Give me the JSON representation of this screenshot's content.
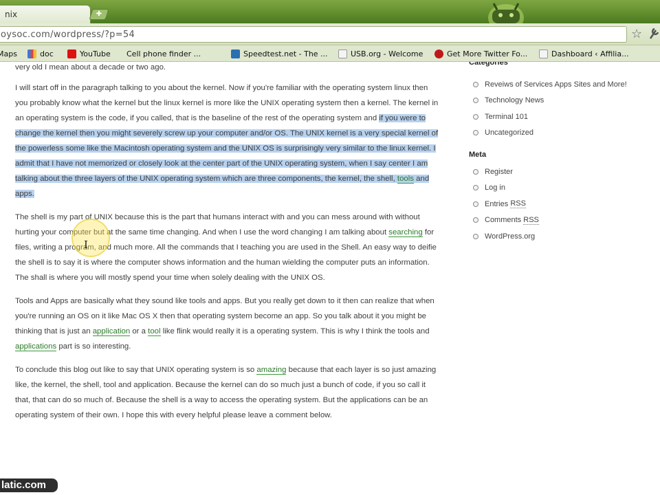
{
  "browser": {
    "tab_title": "nix",
    "url": "oysoc.com/wordpress/?p=54",
    "bookmarks": [
      {
        "label": "Maps",
        "color": "#3b7bd6"
      },
      {
        "label": "doc",
        "color": "#d44"
      },
      {
        "label": "YouTube",
        "color": "#d11"
      },
      {
        "label": "Cell phone finder ...",
        "color": "#e8a23a"
      },
      {
        "label": "Speedtest.net - The ...",
        "color": "#2a6fb0"
      },
      {
        "label": "USB.org - Welcome",
        "color": "#e6e6e6"
      },
      {
        "label": "Get More Twitter Fo...",
        "color": "#c0181a"
      },
      {
        "label": "Dashboard ‹ Affilia...",
        "color": "#f0f0f0"
      }
    ]
  },
  "article": {
    "p0": "very old I mean about a decade or two ago.",
    "p1_a": "I will start off in the paragraph talking to you about the kernel. Now if you're familiar with the operating system linux then you probably know what the kernel but the linux kernel is more like the UNIX operating system then a kernel. The kernel in an operating system is the code, if you called, that is the baseline of the rest of the operating system and ",
    "p1_hl": "if you were to change the kernel then you might severely screw up your computer and/or OS. The UNIX kernel is a very special kernel of the powerless some like the Macintosh operating system and the UNIX OS is surprisingly very similar to the linux kernel. I admit that I have not memorized or closely look at the center part of the UNIX operating system, when I say center I am talking about the three layers of the UNIX operating system which are three components, the kernel, the shell, ",
    "p1_link": "tools",
    "p1_end": " and apps.",
    "p2_a": "The shell is my part of UNIX because this is the part that humans interact with and you can mess around with without hurting your computer but at the same time changing. And when I use the word changing I am talking about ",
    "p2_link": "searching",
    "p2_b": " for files, writing a program, and much more. All the commands that I teaching you are used in the Shell. An easy way to deifie the shell is to say it is where the computer shows information and the human wielding the computer puts an information. The shall is where you will mostly spend your time when solely dealing with the UNIX OS.",
    "p3_a": "Tools and Apps are basically what they sound like tools and apps. But you really get down to it then can realize that when you're running an OS on it like Mac OS X then that operating system become an app. So you talk about it you might be thinking that is just an ",
    "p3_link1": "application",
    "p3_b": " or a ",
    "p3_link2": "tool",
    "p3_c": " like flink would really it is a operating system. This is why I think the tools and ",
    "p3_link3": "applications",
    "p3_d": " part is so interesting.",
    "p4_a": "To conclude this blog out like to say that UNIX operating system is so ",
    "p4_link": "amazing",
    "p4_b": " because that each layer is so just amazing like, the kernel, the shell, tool and application. Because the kernel can do so much just a bunch of code, if you so call it that, that can do so much of. Because the shell is a way to access the operating system. But the applications can be an operating system of their own. I hope this with every helpful please leave a comment below."
  },
  "sidebar": {
    "categories_title": "Categories",
    "categories": [
      "Reveiws of Services Apps Sites and More!",
      "Technology News",
      "Terminal 101",
      "Uncategorized"
    ],
    "meta_title": "Meta",
    "meta": {
      "register": "Register",
      "login": "Log in",
      "entries_prefix": "Entries ",
      "entries_abbr": "RSS",
      "comments_prefix": "Comments ",
      "comments_abbr": "RSS",
      "wordpress": "WordPress.org"
    }
  },
  "watermark": "latic.com"
}
